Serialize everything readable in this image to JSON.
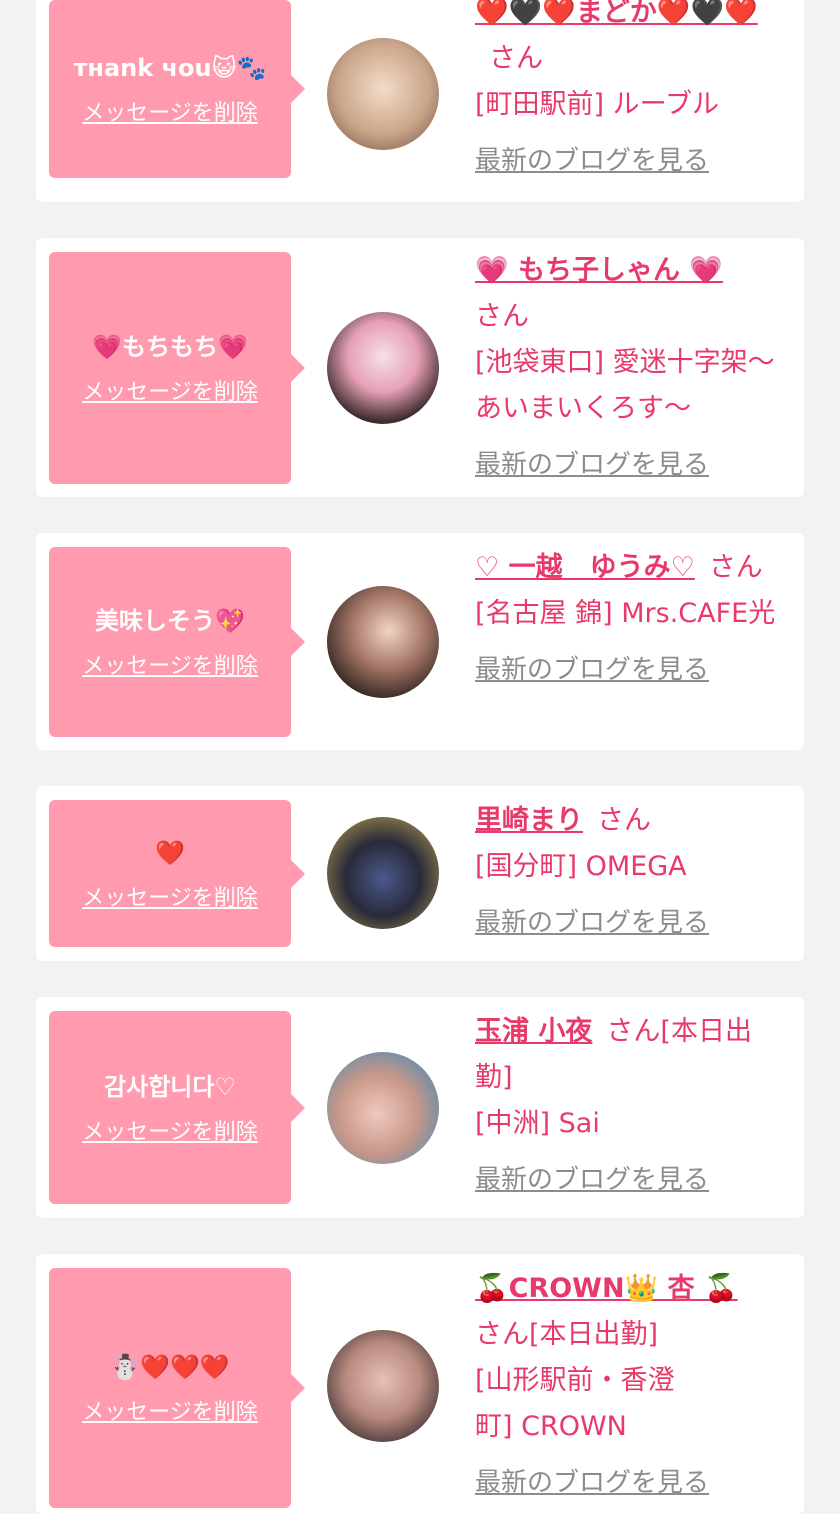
{
  "cards": [
    {
      "message": "тнank чou😺🐾",
      "delete_label": "メッセージを削除",
      "name": "❤️🖤❤️まどか❤️🖤❤️",
      "san": "さん",
      "shop": "[町田駅前] ルーブル",
      "blog_label": "最新のブログを見る"
    },
    {
      "message": "💗もちもち💗",
      "delete_label": "メッセージを削除",
      "name": "💗 もち子しゃん 💗",
      "san": "さん",
      "shop": "[池袋東口] 愛迷十字架～あいまいくろす～",
      "blog_label": "最新のブログを見る"
    },
    {
      "message": "美味しそう💖",
      "delete_label": "メッセージを削除",
      "name": "♡ 一越　ゆうみ♡",
      "san": "さん",
      "shop": "[名古屋 錦] Mrs.CAFE光",
      "blog_label": "最新のブログを見る"
    },
    {
      "message": "❤️",
      "delete_label": "メッセージを削除",
      "name": "里崎まり",
      "san": "さん",
      "shop": "[国分町] OMEGA",
      "blog_label": "最新のブログを見る"
    },
    {
      "message": "감사합니다♡",
      "delete_label": "メッセージを削除",
      "name": "玉浦 小夜",
      "san": "さん[本日出勤]",
      "shop": "[中洲] Sai",
      "blog_label": "最新のブログを見る"
    },
    {
      "message": "☃️❤️❤️❤️",
      "delete_label": "メッセージを削除",
      "name": "🍒CROWN👑 杏 🍒",
      "san": "さん[本日出勤]",
      "shop": "[山形駅前・香澄町] CROWN",
      "blog_label": "最新のブログを見る"
    }
  ],
  "colors": {
    "background": "#f2f2f2",
    "card": "#ffffff",
    "message_box": "#ff9aaf",
    "accent_text": "#e83a6a",
    "blog_link": "#8c8c8c"
  }
}
